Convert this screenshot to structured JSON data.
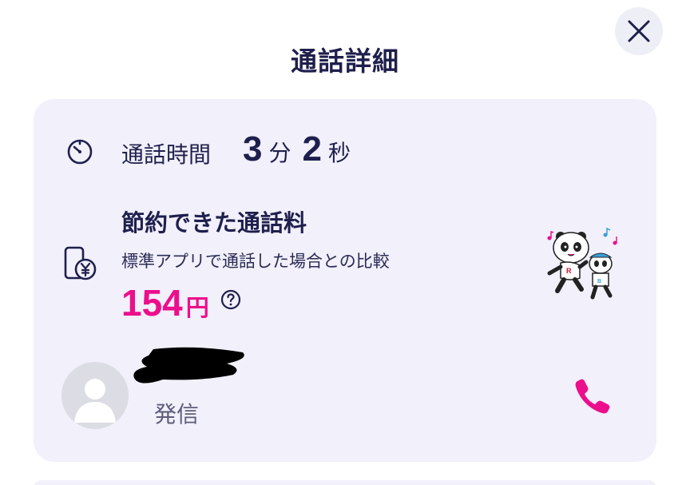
{
  "header": {
    "title": "通話詳細"
  },
  "duration": {
    "label": "通話時間",
    "minutes": "3",
    "minutes_unit": "分",
    "seconds": "2",
    "seconds_unit": "秒"
  },
  "savings": {
    "title": "節約できた通話料",
    "subtitle": "標準アプリで通話した場合との比較",
    "amount": "154",
    "currency_unit": "円"
  },
  "call": {
    "direction": "発信"
  },
  "icons": {
    "close": "close-icon",
    "timer": "timer-icon",
    "phone_yen": "phone-yen-icon",
    "help": "help-icon",
    "call": "phone-call-icon",
    "avatar": "person-avatar-icon",
    "mascot": "panda-mascot-icon"
  },
  "colors": {
    "accent": "#ec0f8c",
    "text": "#1f1f4d",
    "card_bg": "#f1f0fb"
  }
}
